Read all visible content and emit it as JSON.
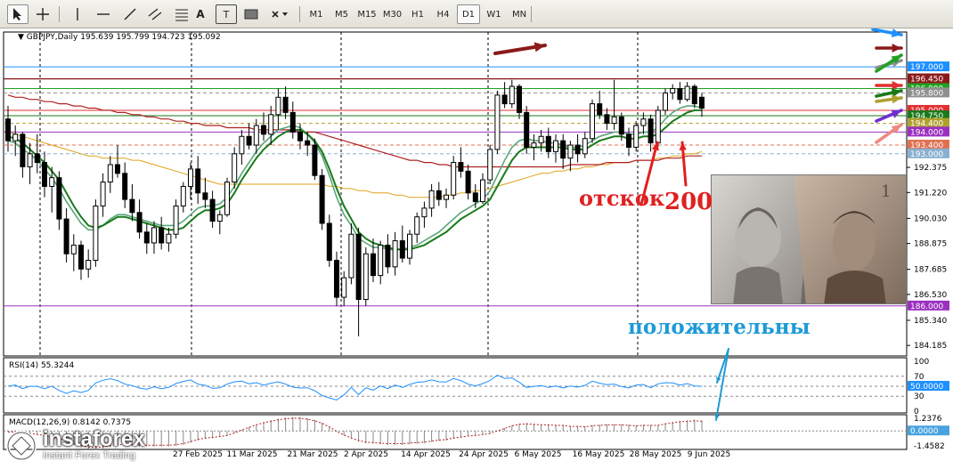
{
  "toolbar": {
    "tools": [
      "cursor-icon",
      "crosshair-icon",
      "vertical-line-icon",
      "horizontal-line-icon",
      "trendline-icon",
      "channel-icon",
      "text-label-icon",
      "text-box-icon",
      "rectangle-icon",
      "shapes-dropdown-icon"
    ],
    "text_tool": "A",
    "text_box_tool": "T",
    "timeframes": [
      "M1",
      "M5",
      "M15",
      "M30",
      "H1",
      "H4",
      "D1",
      "W1",
      "MN"
    ],
    "active_timeframe": "D1"
  },
  "header": {
    "symbol": "GBPJPY,Daily",
    "ohlc": "195.639 195.799 194.723 195.092"
  },
  "rsi_label": "RSI(14) 55.3244",
  "macd_label": "MACD(12,26,9) 0.8142 0.7375",
  "annotations": {
    "otskok": "отскок",
    "ma200": "200",
    "positive": "положительны"
  },
  "watermark": {
    "name": "instaforex",
    "tagline": "Instant Forex Trading"
  },
  "colors": {
    "bg": "#ffffff",
    "candle": "#000000",
    "ma_fast": "#1a7a1a",
    "ma_slow": "#5aa67a",
    "ma_orange": "#e0a21a",
    "ma_200": "#b02020",
    "level_brown": "#8b1a1a",
    "level_green": "#22a022",
    "level_purple": "#9b30c0",
    "rsi": "#1e90ff",
    "macd": "#b22222",
    "annotation_red": "#e02020",
    "annotation_blue": "#1e9ad6"
  },
  "chart_data": {
    "type": "candlestick",
    "symbol": "GBPJPY",
    "timeframe": "Daily",
    "y_ticks": [
      192.375,
      191.22,
      190.03,
      188.875,
      187.685,
      186.53,
      185.34,
      184.185
    ],
    "ylim": [
      183.7,
      198.6
    ],
    "x_labels": [
      "27 Feb 2025",
      "11 Mar 2025",
      "21 Mar 2025",
      "2 Apr 2025",
      "14 Apr 2025",
      "24 Apr 2025",
      "6 May 2025",
      "16 May 2025",
      "28 May 2025",
      "9 Jun 2025"
    ],
    "levels": [
      {
        "value": 197.0,
        "label": "197.000",
        "color": "#1e90ff"
      },
      {
        "value": 196.45,
        "label": "196.450",
        "color": "#8b1a1a"
      },
      {
        "value": 196.0,
        "label": "196.000",
        "color": "#22a022"
      },
      {
        "value": 195.8,
        "label": "195.800",
        "color": "#909090"
      },
      {
        "value": 195.0,
        "label": "195.000",
        "color": "#e03030"
      },
      {
        "value": 194.75,
        "label": "194.750",
        "color": "#1a7a1a"
      },
      {
        "value": 194.4,
        "label": "194.400",
        "color": "#b0a030"
      },
      {
        "value": 194.0,
        "label": "194.000",
        "color": "#9b30c0"
      },
      {
        "value": 193.4,
        "label": "193.400",
        "color": "#e07050"
      },
      {
        "value": 193.0,
        "label": "193.000",
        "color": "#8ab0d0"
      },
      {
        "value": 186.0,
        "label": "186.000",
        "color": "#9b30c0"
      }
    ],
    "candles_ohlc": [
      [
        194.6,
        195.2,
        193.1,
        193.6
      ],
      [
        193.6,
        194.3,
        192.9,
        193.9
      ],
      [
        193.9,
        194.0,
        191.9,
        192.4
      ],
      [
        192.4,
        193.5,
        191.6,
        193.0
      ],
      [
        193.0,
        193.9,
        192.1,
        192.6
      ],
      [
        192.6,
        193.1,
        191.0,
        191.5
      ],
      [
        191.5,
        192.4,
        190.3,
        191.9
      ],
      [
        191.9,
        192.2,
        189.5,
        190.0
      ],
      [
        190.0,
        190.5,
        188.0,
        188.4
      ],
      [
        188.4,
        189.3,
        187.6,
        188.8
      ],
      [
        188.8,
        189.0,
        187.2,
        187.7
      ],
      [
        187.7,
        188.6,
        187.3,
        188.1
      ],
      [
        188.1,
        190.9,
        187.8,
        190.6
      ],
      [
        190.6,
        192.1,
        190.1,
        191.7
      ],
      [
        191.7,
        192.9,
        191.2,
        192.5
      ],
      [
        192.5,
        193.4,
        191.9,
        192.1
      ],
      [
        192.1,
        192.6,
        190.5,
        190.9
      ],
      [
        190.9,
        191.6,
        189.9,
        190.3
      ],
      [
        190.3,
        190.9,
        189.1,
        189.4
      ],
      [
        189.4,
        189.8,
        188.4,
        188.9
      ],
      [
        188.9,
        189.9,
        188.4,
        189.6
      ],
      [
        189.6,
        190.1,
        188.6,
        188.9
      ],
      [
        188.9,
        189.6,
        188.5,
        189.3
      ],
      [
        189.3,
        190.9,
        189.1,
        190.6
      ],
      [
        190.6,
        191.7,
        190.3,
        191.5
      ],
      [
        191.5,
        192.6,
        190.9,
        192.3
      ],
      [
        192.3,
        192.9,
        190.7,
        191.2
      ],
      [
        191.2,
        191.9,
        190.5,
        190.9
      ],
      [
        190.9,
        191.3,
        189.6,
        189.9
      ],
      [
        189.9,
        190.4,
        189.3,
        190.2
      ],
      [
        190.2,
        191.9,
        190.1,
        191.7
      ],
      [
        191.7,
        193.3,
        191.4,
        193.0
      ],
      [
        193.0,
        194.1,
        192.5,
        193.8
      ],
      [
        193.8,
        194.4,
        193.2,
        193.4
      ],
      [
        193.4,
        194.6,
        193.0,
        194.3
      ],
      [
        194.3,
        194.9,
        193.6,
        193.9
      ],
      [
        193.9,
        195.2,
        193.4,
        194.8
      ],
      [
        194.8,
        196.0,
        194.1,
        195.6
      ],
      [
        195.6,
        196.1,
        194.6,
        194.9
      ],
      [
        194.9,
        195.4,
        193.7,
        194.0
      ],
      [
        194.0,
        194.4,
        193.2,
        193.6
      ],
      [
        193.6,
        194.0,
        192.9,
        193.4
      ],
      [
        193.4,
        193.7,
        191.8,
        192.0
      ],
      [
        192.0,
        192.3,
        189.5,
        189.8
      ],
      [
        189.8,
        190.2,
        187.8,
        188.1
      ],
      [
        188.1,
        188.5,
        186.0,
        186.4
      ],
      [
        186.4,
        187.6,
        186.0,
        187.3
      ],
      [
        187.3,
        189.8,
        187.0,
        189.3
      ],
      [
        189.3,
        189.6,
        184.6,
        186.3
      ],
      [
        186.3,
        188.7,
        186.0,
        188.4
      ],
      [
        188.4,
        189.1,
        187.1,
        187.4
      ],
      [
        187.4,
        189.0,
        187.0,
        188.8
      ],
      [
        188.8,
        189.3,
        187.5,
        187.8
      ],
      [
        187.8,
        189.4,
        187.4,
        189.0
      ],
      [
        189.0,
        189.7,
        188.0,
        188.2
      ],
      [
        188.2,
        189.5,
        187.9,
        189.3
      ],
      [
        189.3,
        190.3,
        188.9,
        190.1
      ],
      [
        190.1,
        190.8,
        189.6,
        190.5
      ],
      [
        190.5,
        191.6,
        190.1,
        191.3
      ],
      [
        191.3,
        191.7,
        190.6,
        190.9
      ],
      [
        190.9,
        191.4,
        190.5,
        191.1
      ],
      [
        191.1,
        192.9,
        190.9,
        192.6
      ],
      [
        192.6,
        193.3,
        191.9,
        192.2
      ],
      [
        192.2,
        192.5,
        190.9,
        191.2
      ],
      [
        191.2,
        191.6,
        190.5,
        190.8
      ],
      [
        190.8,
        192.1,
        190.7,
        191.8
      ],
      [
        191.8,
        193.4,
        191.6,
        193.2
      ],
      [
        193.2,
        195.9,
        193.0,
        195.7
      ],
      [
        195.7,
        196.3,
        195.1,
        195.3
      ],
      [
        195.3,
        196.4,
        195.1,
        196.1
      ],
      [
        196.1,
        196.2,
        194.6,
        194.9
      ],
      [
        194.9,
        195.2,
        193.0,
        193.3
      ],
      [
        193.3,
        193.9,
        192.7,
        193.5
      ],
      [
        193.5,
        194.1,
        193.1,
        193.8
      ],
      [
        193.8,
        194.2,
        192.8,
        193.1
      ],
      [
        193.1,
        193.9,
        192.6,
        193.6
      ],
      [
        193.6,
        193.9,
        192.3,
        192.8
      ],
      [
        192.8,
        193.6,
        192.2,
        193.4
      ],
      [
        193.4,
        193.9,
        192.6,
        193.0
      ],
      [
        193.0,
        194.0,
        192.8,
        193.7
      ],
      [
        193.7,
        195.5,
        193.5,
        195.3
      ],
      [
        195.3,
        195.9,
        194.6,
        194.8
      ],
      [
        194.8,
        195.1,
        194.1,
        194.4
      ],
      [
        194.4,
        196.4,
        194.1,
        194.7
      ],
      [
        194.7,
        194.9,
        193.6,
        193.9
      ],
      [
        193.9,
        194.2,
        192.9,
        193.3
      ],
      [
        193.3,
        194.5,
        193.1,
        194.3
      ],
      [
        194.3,
        194.9,
        193.9,
        194.6
      ],
      [
        194.6,
        194.8,
        193.1,
        193.5
      ],
      [
        193.5,
        195.2,
        193.3,
        195.0
      ],
      [
        195.0,
        196.0,
        194.8,
        195.8
      ],
      [
        195.8,
        196.2,
        195.5,
        196.0
      ],
      [
        196.0,
        196.3,
        195.3,
        195.5
      ],
      [
        195.5,
        196.3,
        195.4,
        196.1
      ],
      [
        196.1,
        196.2,
        195.1,
        195.3
      ],
      [
        195.6,
        195.8,
        194.7,
        195.1
      ]
    ],
    "ma_fast": [
      193.8,
      193.7,
      193.5,
      193.2,
      192.9,
      192.6,
      192.2,
      191.8,
      191.2,
      190.6,
      190.1,
      189.7,
      189.6,
      189.7,
      189.9,
      190.1,
      190.1,
      190.0,
      189.9,
      189.8,
      189.7,
      189.6,
      189.5,
      189.5,
      189.6,
      189.9,
      190.2,
      190.4,
      190.4,
      190.5,
      190.7,
      191.2,
      191.8,
      192.3,
      192.8,
      193.2,
      193.5,
      193.8,
      194.0,
      194.1,
      194.1,
      193.9,
      193.6,
      193.1,
      192.3,
      191.4,
      190.6,
      190.0,
      189.4,
      189.1,
      188.9,
      188.8,
      188.7,
      188.6,
      188.6,
      188.6,
      188.7,
      188.8,
      189.0,
      189.2,
      189.4,
      189.7,
      190.0,
      190.2,
      190.4,
      190.6,
      190.9,
      191.5,
      192.1,
      192.7,
      193.1,
      193.3,
      193.3,
      193.3,
      193.3,
      193.3,
      193.3,
      193.2,
      193.2,
      193.2,
      193.4,
      193.6,
      193.7,
      193.8,
      193.8,
      193.7,
      193.7,
      193.8,
      193.8,
      193.9,
      194.2,
      194.5,
      194.7,
      194.9,
      195.0,
      195.0
    ],
    "ma_slow": [
      193.6,
      193.5,
      193.2,
      193.0,
      192.7,
      192.3,
      191.9,
      191.4,
      190.8,
      190.3,
      189.8,
      189.5,
      189.5,
      189.7,
      190.0,
      190.2,
      190.2,
      190.1,
      190.0,
      189.9,
      189.8,
      189.7,
      189.7,
      189.7,
      189.9,
      190.2,
      190.5,
      190.6,
      190.6,
      190.7,
      191.0,
      191.5,
      192.1,
      192.6,
      193.1,
      193.5,
      193.8,
      194.1,
      194.2,
      194.3,
      194.2,
      193.9,
      193.5,
      192.9,
      192.0,
      191.0,
      190.2,
      189.7,
      189.1,
      188.9,
      188.7,
      188.7,
      188.6,
      188.6,
      188.6,
      188.7,
      188.8,
      189.0,
      189.2,
      189.4,
      189.7,
      190.0,
      190.3,
      190.5,
      190.7,
      190.9,
      191.3,
      192.0,
      192.7,
      193.3,
      193.6,
      193.7,
      193.6,
      193.6,
      193.5,
      193.5,
      193.4,
      193.3,
      193.3,
      193.4,
      193.6,
      193.8,
      193.9,
      194.0,
      194.0,
      193.9,
      193.9,
      194.0,
      194.0,
      194.2,
      194.6,
      194.9,
      195.1,
      195.2,
      195.2,
      195.1
    ],
    "ma_orange": [
      194.0,
      193.9,
      193.8,
      193.7,
      193.6,
      193.5,
      193.4,
      193.3,
      193.2,
      193.1,
      193.0,
      192.9,
      192.9,
      192.8,
      192.8,
      192.8,
      192.8,
      192.7,
      192.7,
      192.6,
      192.5,
      192.4,
      192.3,
      192.2,
      192.1,
      192.0,
      191.9,
      191.8,
      191.7,
      191.6,
      191.6,
      191.6,
      191.6,
      191.6,
      191.6,
      191.6,
      191.6,
      191.6,
      191.6,
      191.6,
      191.6,
      191.6,
      191.6,
      191.6,
      191.5,
      191.5,
      191.4,
      191.4,
      191.3,
      191.3,
      191.2,
      191.2,
      191.2,
      191.1,
      191.1,
      191.0,
      191.0,
      191.0,
      191.0,
      191.0,
      191.1,
      191.1,
      191.2,
      191.2,
      191.3,
      191.3,
      191.4,
      191.5,
      191.6,
      191.7,
      191.8,
      191.9,
      192.0,
      192.1,
      192.1,
      192.2,
      192.2,
      192.3,
      192.3,
      192.4,
      192.4,
      192.5,
      192.5,
      192.6,
      192.6,
      192.6,
      192.7,
      192.7,
      192.7,
      192.8,
      192.8,
      192.9,
      192.9,
      193.0,
      193.0,
      193.1
    ],
    "ma_200": [
      195.7,
      195.6,
      195.6,
      195.5,
      195.5,
      195.4,
      195.4,
      195.3,
      195.3,
      195.2,
      195.2,
      195.1,
      195.1,
      195.0,
      195.0,
      194.9,
      194.9,
      194.8,
      194.8,
      194.7,
      194.7,
      194.6,
      194.6,
      194.5,
      194.5,
      194.4,
      194.4,
      194.3,
      194.3,
      194.3,
      194.2,
      194.2,
      194.2,
      194.2,
      194.1,
      194.1,
      194.1,
      194.1,
      194.1,
      194.1,
      194.0,
      194.0,
      194.0,
      193.9,
      193.8,
      193.7,
      193.6,
      193.5,
      193.4,
      193.3,
      193.2,
      193.1,
      193.0,
      192.9,
      192.8,
      192.7,
      192.7,
      192.6,
      192.6,
      192.5,
      192.5,
      192.4,
      192.4,
      192.4,
      192.4,
      192.4,
      192.4,
      192.4,
      192.4,
      192.4,
      192.4,
      192.4,
      192.4,
      192.4,
      192.4,
      192.4,
      192.4,
      192.5,
      192.5,
      192.5,
      192.5,
      192.5,
      192.6,
      192.6,
      192.6,
      192.6,
      192.7,
      192.7,
      192.7,
      192.7,
      192.8,
      192.8,
      192.8,
      192.9,
      192.9,
      192.9
    ],
    "rsi": {
      "value": 55.3244,
      "levels": [
        100,
        70,
        50,
        30,
        0
      ],
      "marker": "50.0000"
    },
    "macd": {
      "main": 0.8142,
      "signal": 0.7375,
      "ticks": [
        "1.2376",
        "0.0000",
        "-1.4582"
      ]
    }
  }
}
